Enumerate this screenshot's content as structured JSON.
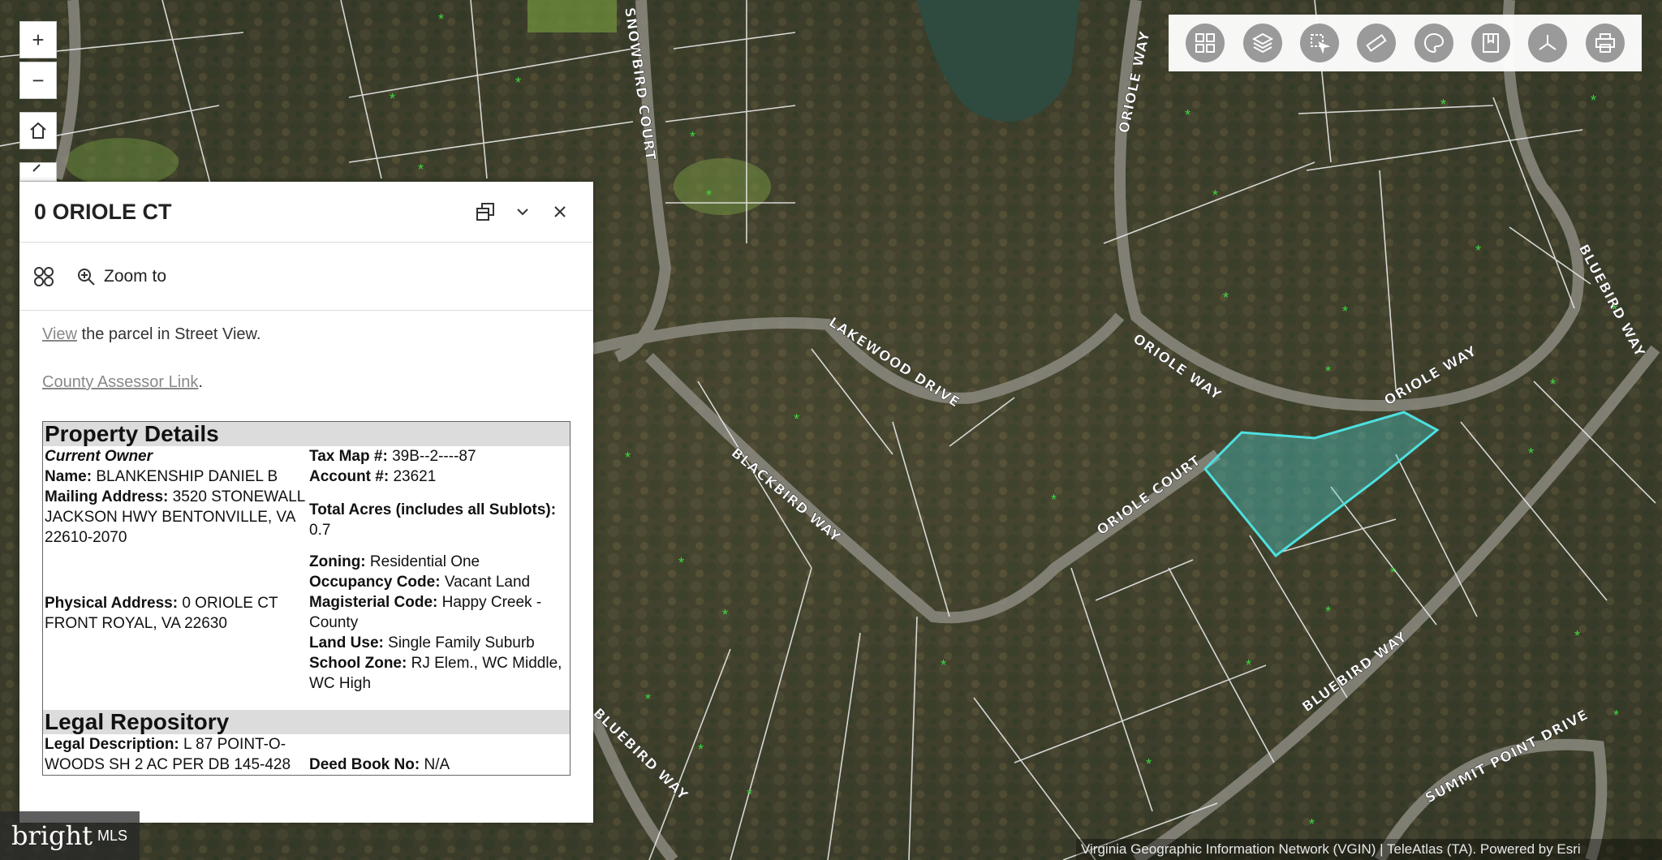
{
  "popup": {
    "title": "0 ORIOLE CT",
    "zoom_label": "Zoom to",
    "street_view_link": "View",
    "street_view_text": " the parcel in Street View.",
    "assessor_link": "County Assessor Link",
    "assessor_suffix": "."
  },
  "property_details": {
    "heading": "Property Details",
    "current_owner_label": "Current Owner",
    "name_label": "Name:",
    "name_value": "BLANKENSHIP DANIEL B",
    "mailing_label": "Mailing Address:",
    "mailing_value": "3520 STONEWALL JACKSON HWY BENTONVILLE, VA 22610-2070",
    "physical_label": "Physical Address:",
    "physical_value": "0 ORIOLE CT FRONT ROYAL, VA 22630",
    "tax_map_label": "Tax Map #:",
    "tax_map_value": "39B--2----87",
    "account_label": "Account #:",
    "account_value": "23621",
    "acres_label": "Total Acres (includes all Sublots):",
    "acres_value": "0.7",
    "zoning_label": "Zoning:",
    "zoning_value": "Residential One",
    "occupancy_label": "Occupancy Code:",
    "occupancy_value": "Vacant Land",
    "magisterial_label": "Magisterial Code:",
    "magisterial_value": "Happy Creek - County",
    "land_use_label": "Land Use:",
    "land_use_value": "Single Family Suburb",
    "school_label": "School Zone:",
    "school_value": "RJ Elem., WC Middle, WC High"
  },
  "legal": {
    "heading": "Legal Repository",
    "desc_label": "Legal Description:",
    "desc_value": "L 87 POINT-O-WOODS SH 2 AC PER DB 145-428",
    "deed_label": "Deed Book No:",
    "deed_value": "N/A"
  },
  "map": {
    "road_labels": [
      "SNOWBIRD COURT",
      "ORIOLE WAY",
      "LAKEWOOD DRIVE",
      "ORIOLE WAY",
      "ORIOLE WAY",
      "BLUEBIRD WAY",
      "BLACKBIRD WAY",
      "ORIOLE COURT",
      "BLUEBIRD WAY",
      "SUMMIT POINT DRIVE",
      "BLUEBIRD WAY"
    ],
    "parcel_color": "#4de0e0",
    "credit": "Virginia Geographic Information Network (VGIN) | TeleAtlas (TA). Powered by Esri"
  },
  "controls": {
    "zoom_in": "+",
    "zoom_out": "−"
  },
  "logo": {
    "brand": "bright",
    "suffix": "MLS"
  }
}
